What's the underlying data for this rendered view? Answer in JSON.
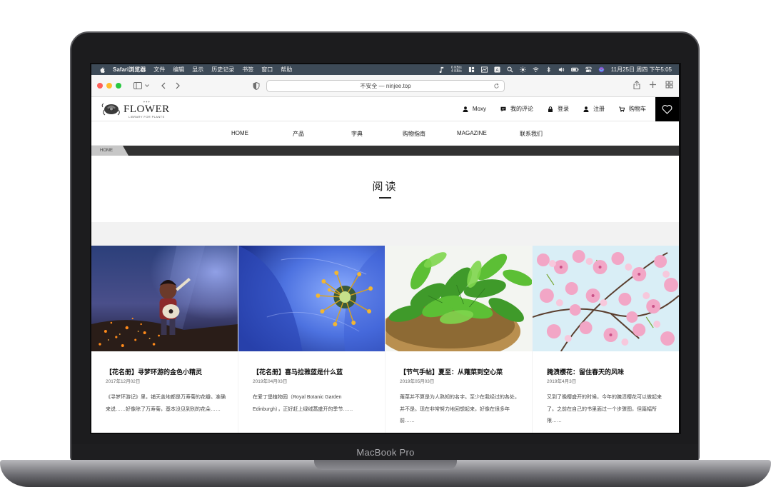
{
  "menubar": {
    "app_name": "Safari浏览器",
    "items": [
      "文件",
      "编辑",
      "显示",
      "历史记录",
      "书签",
      "窗口",
      "帮助"
    ],
    "net_up": "6 KB/s",
    "net_down": "4 KB/s",
    "datetime": "11月25日 周四 下午5:05"
  },
  "toolbar": {
    "url": "不安全 — ninjee.top"
  },
  "site": {
    "logo_text": "FLOWER",
    "logo_subtitle": "LIBRARY FOR PLANTS",
    "header_nav": [
      {
        "label": "Moxy",
        "icon": "user-icon"
      },
      {
        "label": "我的评论",
        "icon": "comment-icon"
      },
      {
        "label": "登录",
        "icon": "lock-icon"
      },
      {
        "label": "注册",
        "icon": "user-icon"
      },
      {
        "label": "购物车",
        "icon": "cart-icon"
      }
    ],
    "main_nav": [
      "HOME",
      "产品",
      "字典",
      "购物指南",
      "MAGAZINE",
      "联系我们"
    ],
    "breadcrumb": "HOME",
    "page_title": "阅读"
  },
  "cards": [
    {
      "title": "【花名册】寻梦环游的金色小精灵",
      "date": "2017年12月02日",
      "excerpt": "《寻梦环游记》里，铺天盖地都是万寿菊的花瓣。准确来说……好像除了万寿菊，基本没见到别的花朵……"
    },
    {
      "title": "【花名册】喜马拉雅蓝是什么蓝",
      "date": "2019年04月03日",
      "excerpt": "在爱丁堡植物园（Royal Botanic Garden Edinburgh），正好赶上绿绒蒿盛开的季节……"
    },
    {
      "title": "【节气手帖】夏至：从蕹菜到空心菜",
      "date": "2019年05月03日",
      "excerpt": "蕹菜并不算是为人熟知的名字。至少在我经过的各处，并不是。现在非常努力地回想起来，好像在很多年前……"
    },
    {
      "title": "腌渍樱花：留住春天的风味",
      "date": "2019年4月3日",
      "excerpt": "又到了晚樱盛开的时候，今年的腌渍樱花可以做起来了。之前在自己的书里面过一个步骤图，但篇幅所限……"
    }
  ],
  "device_label": "MacBook Pro",
  "colors": {
    "menubar_bg": "#3d4a57",
    "crumbbar_bg": "#323232",
    "heart_box_bg": "#000000",
    "traffic_red": "#ff5f57",
    "traffic_yellow": "#febc2e",
    "traffic_green": "#28c840"
  }
}
